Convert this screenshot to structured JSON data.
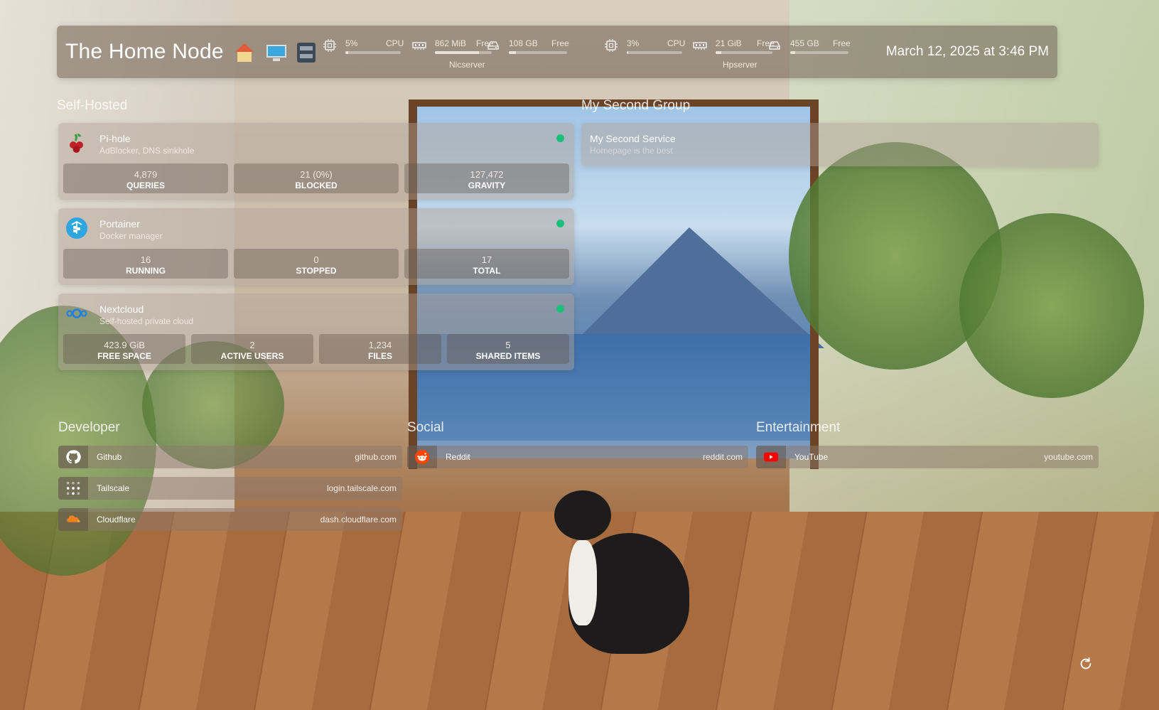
{
  "header": {
    "title": "The Home Node",
    "datetime": "March 12, 2025 at 3:46 PM",
    "servers": [
      {
        "name": "Nicserver",
        "cpu": {
          "value": "5%",
          "label": "CPU",
          "percent": 5
        },
        "memory": {
          "value": "862 MiB",
          "label": "Free",
          "percent": 78
        },
        "disk": {
          "value": "108 GB",
          "label": "Free",
          "percent": 12
        }
      },
      {
        "name": "Hpserver",
        "cpu": {
          "value": "3%",
          "label": "CPU",
          "percent": 3
        },
        "memory": {
          "value": "21 GiB",
          "label": "Free",
          "percent": 10
        },
        "disk": {
          "value": "455 GB",
          "label": "Free",
          "percent": 8
        }
      }
    ]
  },
  "groups": {
    "self_hosted": {
      "title": "Self-Hosted",
      "services": [
        {
          "name": "Pi-hole",
          "description": "AdBlocker, DNS sinkhole",
          "icon": "pihole-icon",
          "status": "online",
          "stats": [
            {
              "value": "4,879",
              "label": "QUERIES"
            },
            {
              "value": "21 (0%)",
              "label": "BLOCKED"
            },
            {
              "value": "127,472",
              "label": "GRAVITY"
            }
          ]
        },
        {
          "name": "Portainer",
          "description": "Docker manager",
          "icon": "portainer-icon",
          "status": "online",
          "stats": [
            {
              "value": "16",
              "label": "RUNNING"
            },
            {
              "value": "0",
              "label": "STOPPED"
            },
            {
              "value": "17",
              "label": "TOTAL"
            }
          ]
        },
        {
          "name": "Nextcloud",
          "description": "Self-hosted private cloud",
          "icon": "nextcloud-icon",
          "status": "online",
          "stats": [
            {
              "value": "423.9 GiB",
              "label": "FREE SPACE"
            },
            {
              "value": "2",
              "label": "ACTIVE USERS"
            },
            {
              "value": "1,234",
              "label": "FILES"
            },
            {
              "value": "5",
              "label": "SHARED ITEMS"
            }
          ]
        }
      ]
    },
    "second": {
      "title": "My Second Group",
      "services": [
        {
          "name": "My Second Service",
          "description": "Homepage is the best"
        }
      ]
    }
  },
  "bookmarks": {
    "developer": {
      "title": "Developer",
      "items": [
        {
          "name": "Github",
          "url": "github.com",
          "icon": "github-icon"
        },
        {
          "name": "Tailscale",
          "url": "login.tailscale.com",
          "icon": "tailscale-icon"
        },
        {
          "name": "Cloudflare",
          "url": "dash.cloudflare.com",
          "icon": "cloudflare-icon"
        }
      ]
    },
    "social": {
      "title": "Social",
      "items": [
        {
          "name": "Reddit",
          "url": "reddit.com",
          "icon": "reddit-icon"
        }
      ]
    },
    "entertainment": {
      "title": "Entertainment",
      "items": [
        {
          "name": "YouTube",
          "url": "youtube.com",
          "icon": "youtube-icon"
        }
      ]
    }
  },
  "colors": {
    "status_online": "#1bbf7a",
    "header_bg": "#6e5c4e"
  },
  "refresh": {
    "icon": "refresh-icon"
  }
}
